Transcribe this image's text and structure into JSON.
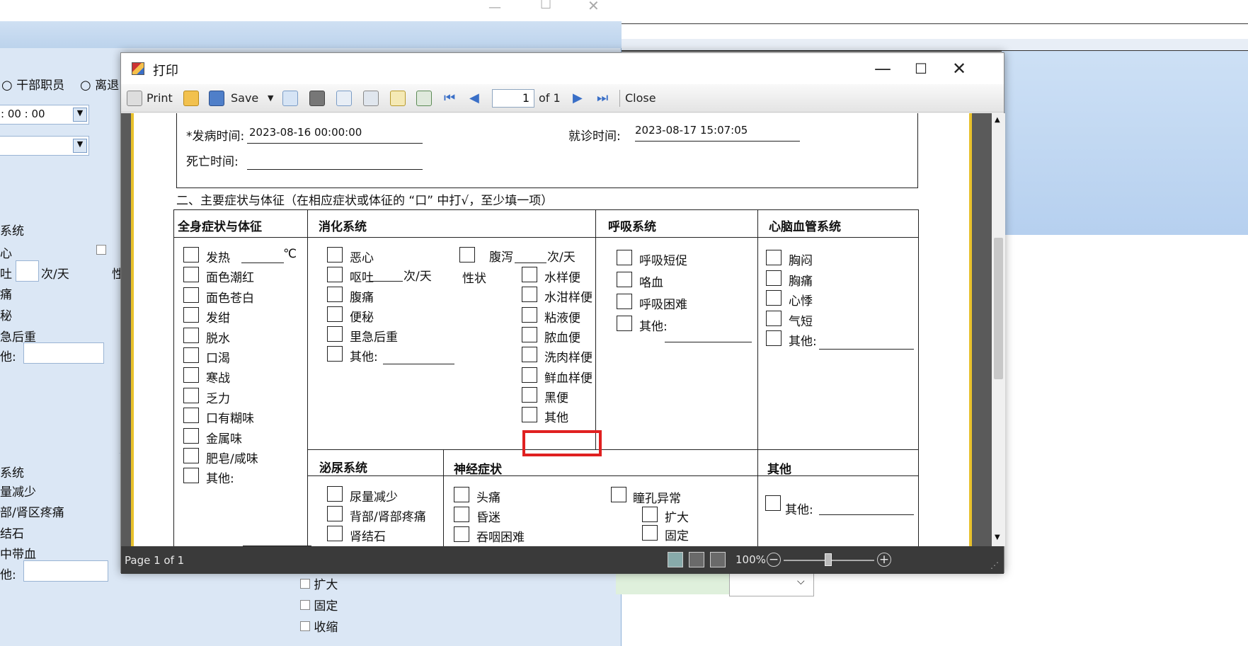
{
  "background": {
    "radio_cadre": "干部职员",
    "radio_retired": "离退",
    "time_value": ": 00 : 00",
    "cb_nausea": "心",
    "vomit_unit": "次/天",
    "vomit_label": "吐",
    "abd_pain": "痛",
    "constipation": "秘",
    "tenesmus": "急后重",
    "other": "他:",
    "section_sys": "系统",
    "urine_less": "量减少",
    "back_pain": "部/肾区疼痛",
    "kidney_stone": "结石",
    "blood_urine": "中带血",
    "other2": "他:",
    "sys2": "系统",
    "dilate": "扩大",
    "fixed": "固定",
    "shrink": "收缩",
    "sex_char": "性"
  },
  "dialog": {
    "title": "打印",
    "toolbar": {
      "print": "Print",
      "save": "Save",
      "page_value": "1",
      "of_pages": "of 1",
      "close": "Close"
    },
    "status": {
      "page_info": "Page 1 of 1",
      "zoom": "100%"
    }
  },
  "form": {
    "onset_label": "*发病时间:",
    "onset_value": "2023-08-16 00:00:00",
    "visit_label": "就诊时间:",
    "visit_value": "2023-08-17 15:07:05",
    "death_label": "死亡时间:",
    "section2": "二、主要症状与体征（在相应症状或体征的 “口” 中打√，至少填一项）",
    "general": {
      "header": "全身症状与体征",
      "items": [
        "发热",
        "面色潮红",
        "面色苍白",
        "发绀",
        "脱水",
        "口渴",
        "寒战",
        "乏力",
        "口有糊味",
        "金属味",
        "肥皂/咸味",
        "其他:"
      ],
      "fever_unit": "℃"
    },
    "digestive": {
      "header": "消化系统",
      "items": [
        "恶心",
        "呕吐",
        "腹痛",
        "便秘",
        "里急后重",
        "其他:"
      ],
      "vomit_unit": "次/天",
      "diarrhea": "腹泻",
      "diarrhea_unit": "次/天",
      "stool_label": "性状",
      "stool": [
        "水样便",
        "水泔样便",
        "粘液便",
        "脓血便",
        "洗肉样便",
        "鲜血样便",
        "黑便",
        "其他"
      ]
    },
    "respiratory": {
      "header": "呼吸系统",
      "items": [
        "呼吸短促",
        "咯血",
        "呼吸困难",
        "其他:"
      ]
    },
    "cardio": {
      "header": "心脑血管系统",
      "items": [
        "胸闷",
        "胸痛",
        "心悸",
        "气短",
        "其他:"
      ]
    },
    "urinary": {
      "header": "泌尿系统",
      "items": [
        "尿量减少",
        "背部/肾部疼痛",
        "肾结石"
      ]
    },
    "neuro": {
      "header": "神经症状",
      "items": [
        "头痛",
        "昏迷",
        "吞咽困难"
      ],
      "pupil": "瞳孔异常",
      "pupil_items": [
        "扩大",
        "固定"
      ]
    },
    "other": {
      "header": "其他",
      "item": "其他:"
    }
  }
}
